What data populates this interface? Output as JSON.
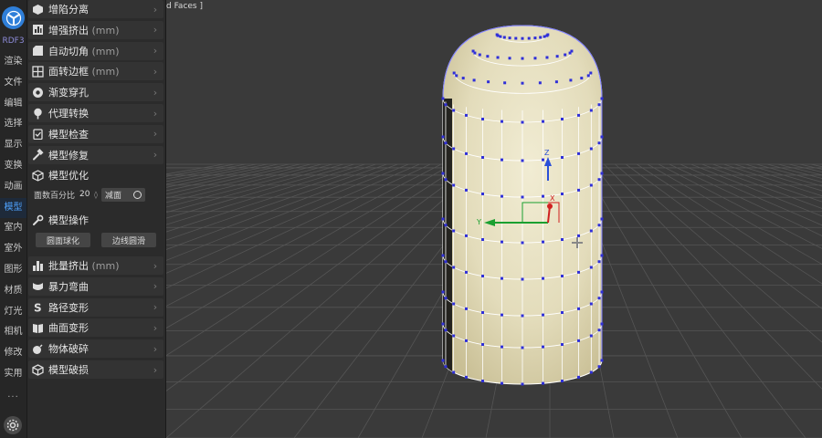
{
  "rail": {
    "brand": "RDF3",
    "items": [
      {
        "label": "渲染",
        "active": false
      },
      {
        "label": "文件",
        "active": false
      },
      {
        "label": "编辑",
        "active": false
      },
      {
        "label": "选择",
        "active": false
      },
      {
        "label": "显示",
        "active": false
      },
      {
        "label": "变换",
        "active": false
      },
      {
        "label": "动画",
        "active": false
      },
      {
        "label": "模型",
        "active": true
      },
      {
        "label": "室内",
        "active": false
      },
      {
        "label": "室外",
        "active": false
      },
      {
        "label": "图形",
        "active": false
      },
      {
        "label": "材质",
        "active": false
      },
      {
        "label": "灯光",
        "active": false
      },
      {
        "label": "相机",
        "active": false
      },
      {
        "label": "修改",
        "active": false
      },
      {
        "label": "实用",
        "active": false
      }
    ],
    "more": "···"
  },
  "panel": {
    "rows": [
      {
        "label": "增陷分离",
        "unit": "",
        "icon": "cube-split-icon"
      },
      {
        "label": "增强挤出",
        "unit": " (mm)",
        "icon": "extrude-icon"
      },
      {
        "label": "自动切角",
        "unit": " (mm)",
        "icon": "chamfer-icon"
      },
      {
        "label": "面转边框",
        "unit": " (mm)",
        "icon": "grid-frame-icon"
      },
      {
        "label": "渐变穿孔",
        "unit": "",
        "icon": "hole-icon"
      },
      {
        "label": "代理转换",
        "unit": "",
        "icon": "tree-icon"
      },
      {
        "label": "模型检查",
        "unit": "",
        "icon": "clipboard-check-icon"
      },
      {
        "label": "模型修复",
        "unit": "",
        "icon": "hammer-icon"
      }
    ],
    "optimize": {
      "title": "模型优化",
      "percent_label": "面数百分比",
      "percent_value": "20",
      "reduce_label": "减面"
    },
    "operate": {
      "title": "模型操作",
      "btn_round": "圆面球化",
      "btn_edge": "边线圆滑"
    },
    "rows2": [
      {
        "label": "批量挤出",
        "unit": " (mm)",
        "icon": "bar-chart-icon"
      },
      {
        "label": "暴力弯曲",
        "unit": "",
        "icon": "bend-icon"
      },
      {
        "label": "路径变形",
        "unit": "",
        "icon": "path-s-icon"
      },
      {
        "label": "曲面变形",
        "unit": "",
        "icon": "book-icon"
      },
      {
        "label": "物体破碎",
        "unit": "",
        "icon": "bomb-icon"
      },
      {
        "label": "模型破损",
        "unit": "",
        "icon": "broken-cube-icon"
      }
    ]
  },
  "viewport": {
    "label": "d Faces ]",
    "axis_x": "X",
    "axis_y": "Y",
    "axis_z": "Z"
  }
}
